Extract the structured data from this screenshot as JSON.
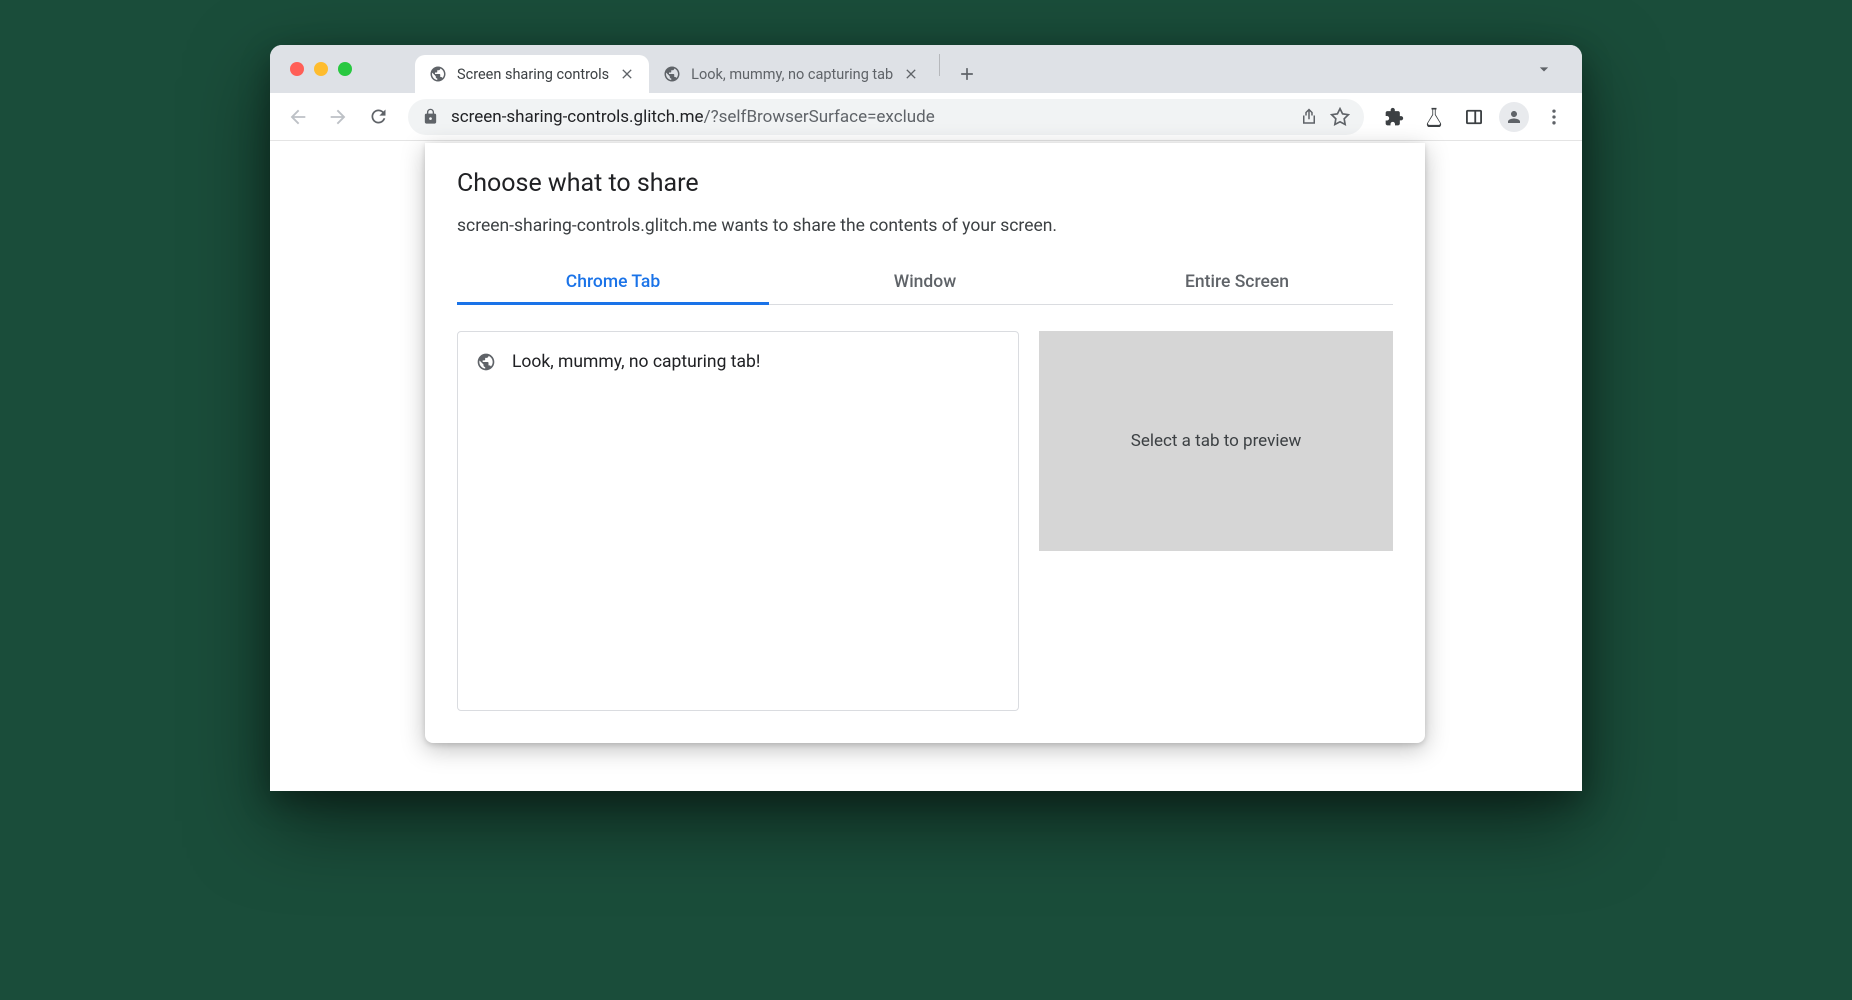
{
  "browser": {
    "tabs": [
      {
        "title": "Screen sharing controls",
        "active": true
      },
      {
        "title": "Look, mummy, no capturing tab",
        "active": false
      }
    ],
    "url": {
      "domain": "screen-sharing-controls.glitch.me",
      "path": "/?selfBrowserSurface=exclude"
    }
  },
  "dialog": {
    "title": "Choose what to share",
    "subtitle": "screen-sharing-controls.glitch.me wants to share the contents of your screen.",
    "tabs": [
      {
        "label": "Chrome Tab",
        "active": true
      },
      {
        "label": "Window",
        "active": false
      },
      {
        "label": "Entire Screen",
        "active": false
      }
    ],
    "tabList": [
      {
        "title": "Look, mummy, no capturing tab!"
      }
    ],
    "previewPlaceholder": "Select a tab to preview"
  }
}
